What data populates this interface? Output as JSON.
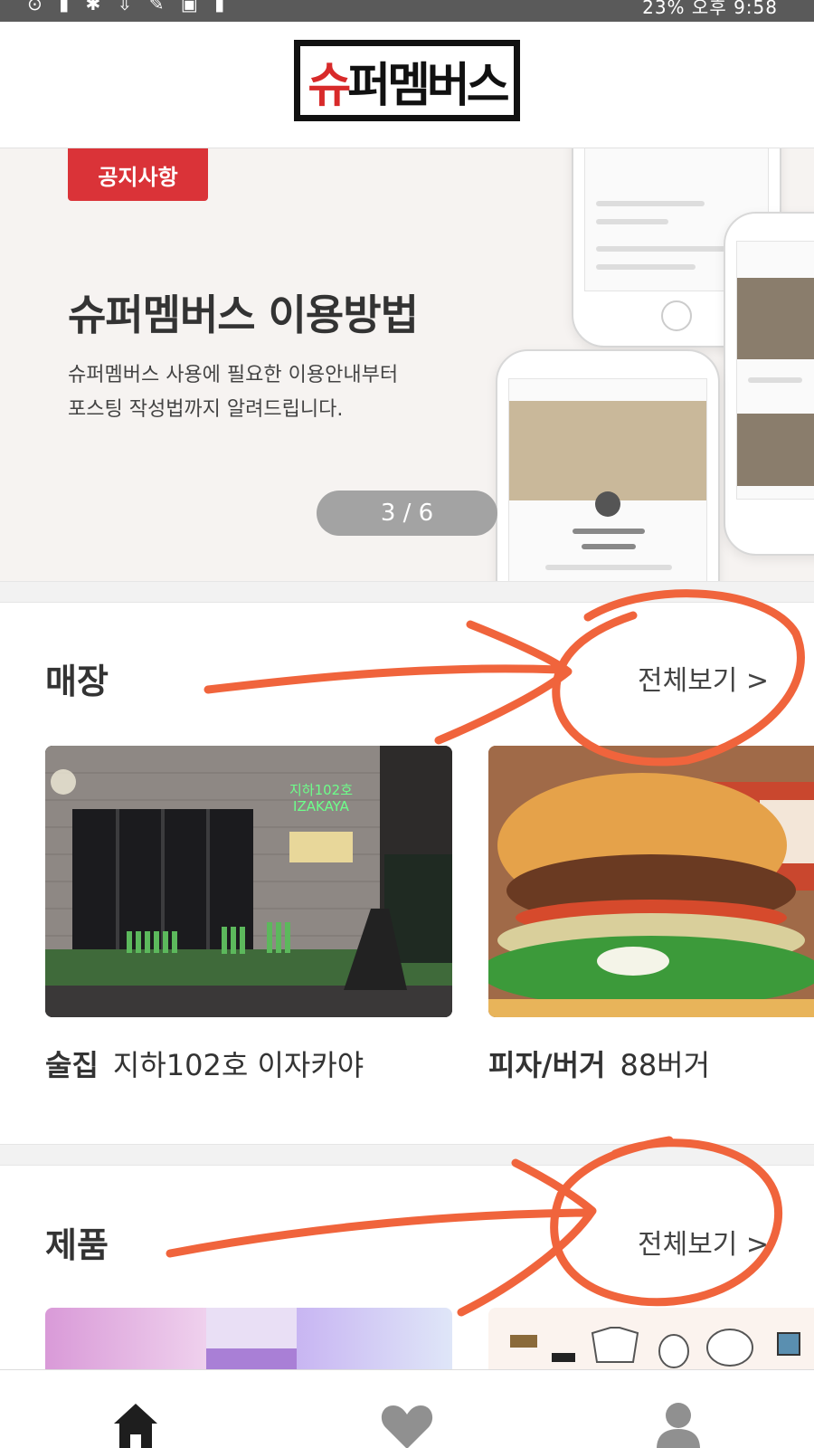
{
  "status_bar": {
    "left_icons": [
      "notification-icon",
      "notification-icon",
      "settings-icon",
      "download-icon",
      "notification-icon",
      "notification-icon",
      "notification-icon"
    ],
    "right_text": "23% 오후 9:58"
  },
  "header": {
    "logo_text_first": "슈",
    "logo_text_rest": "퍼멤버스"
  },
  "banner": {
    "badge": "공지사항",
    "title": "슈퍼멤버스 이용방법",
    "desc_line1": "슈퍼멤버스 사용에 필요한 이용안내부터",
    "desc_line2": "포스팅 작성법까지 알려드립니다.",
    "pager": "3 / 6"
  },
  "stores": {
    "title": "매장",
    "see_all": "전체보기 >",
    "items": [
      {
        "category": "술집",
        "name": "지하102호 이자카야",
        "sign": "지하102호 IZAKAYA"
      },
      {
        "category": "피자/버거",
        "name": "88버거"
      }
    ]
  },
  "products": {
    "title": "제품",
    "see_all": "전체보기 >"
  },
  "bottom_nav": {
    "items": [
      {
        "icon": "home-icon",
        "active": true
      },
      {
        "icon": "heart-icon",
        "active": false
      },
      {
        "icon": "profile-icon",
        "active": false
      }
    ]
  },
  "colors": {
    "accent": "#da3338",
    "annotation": "#f0643c",
    "text": "#333333"
  }
}
